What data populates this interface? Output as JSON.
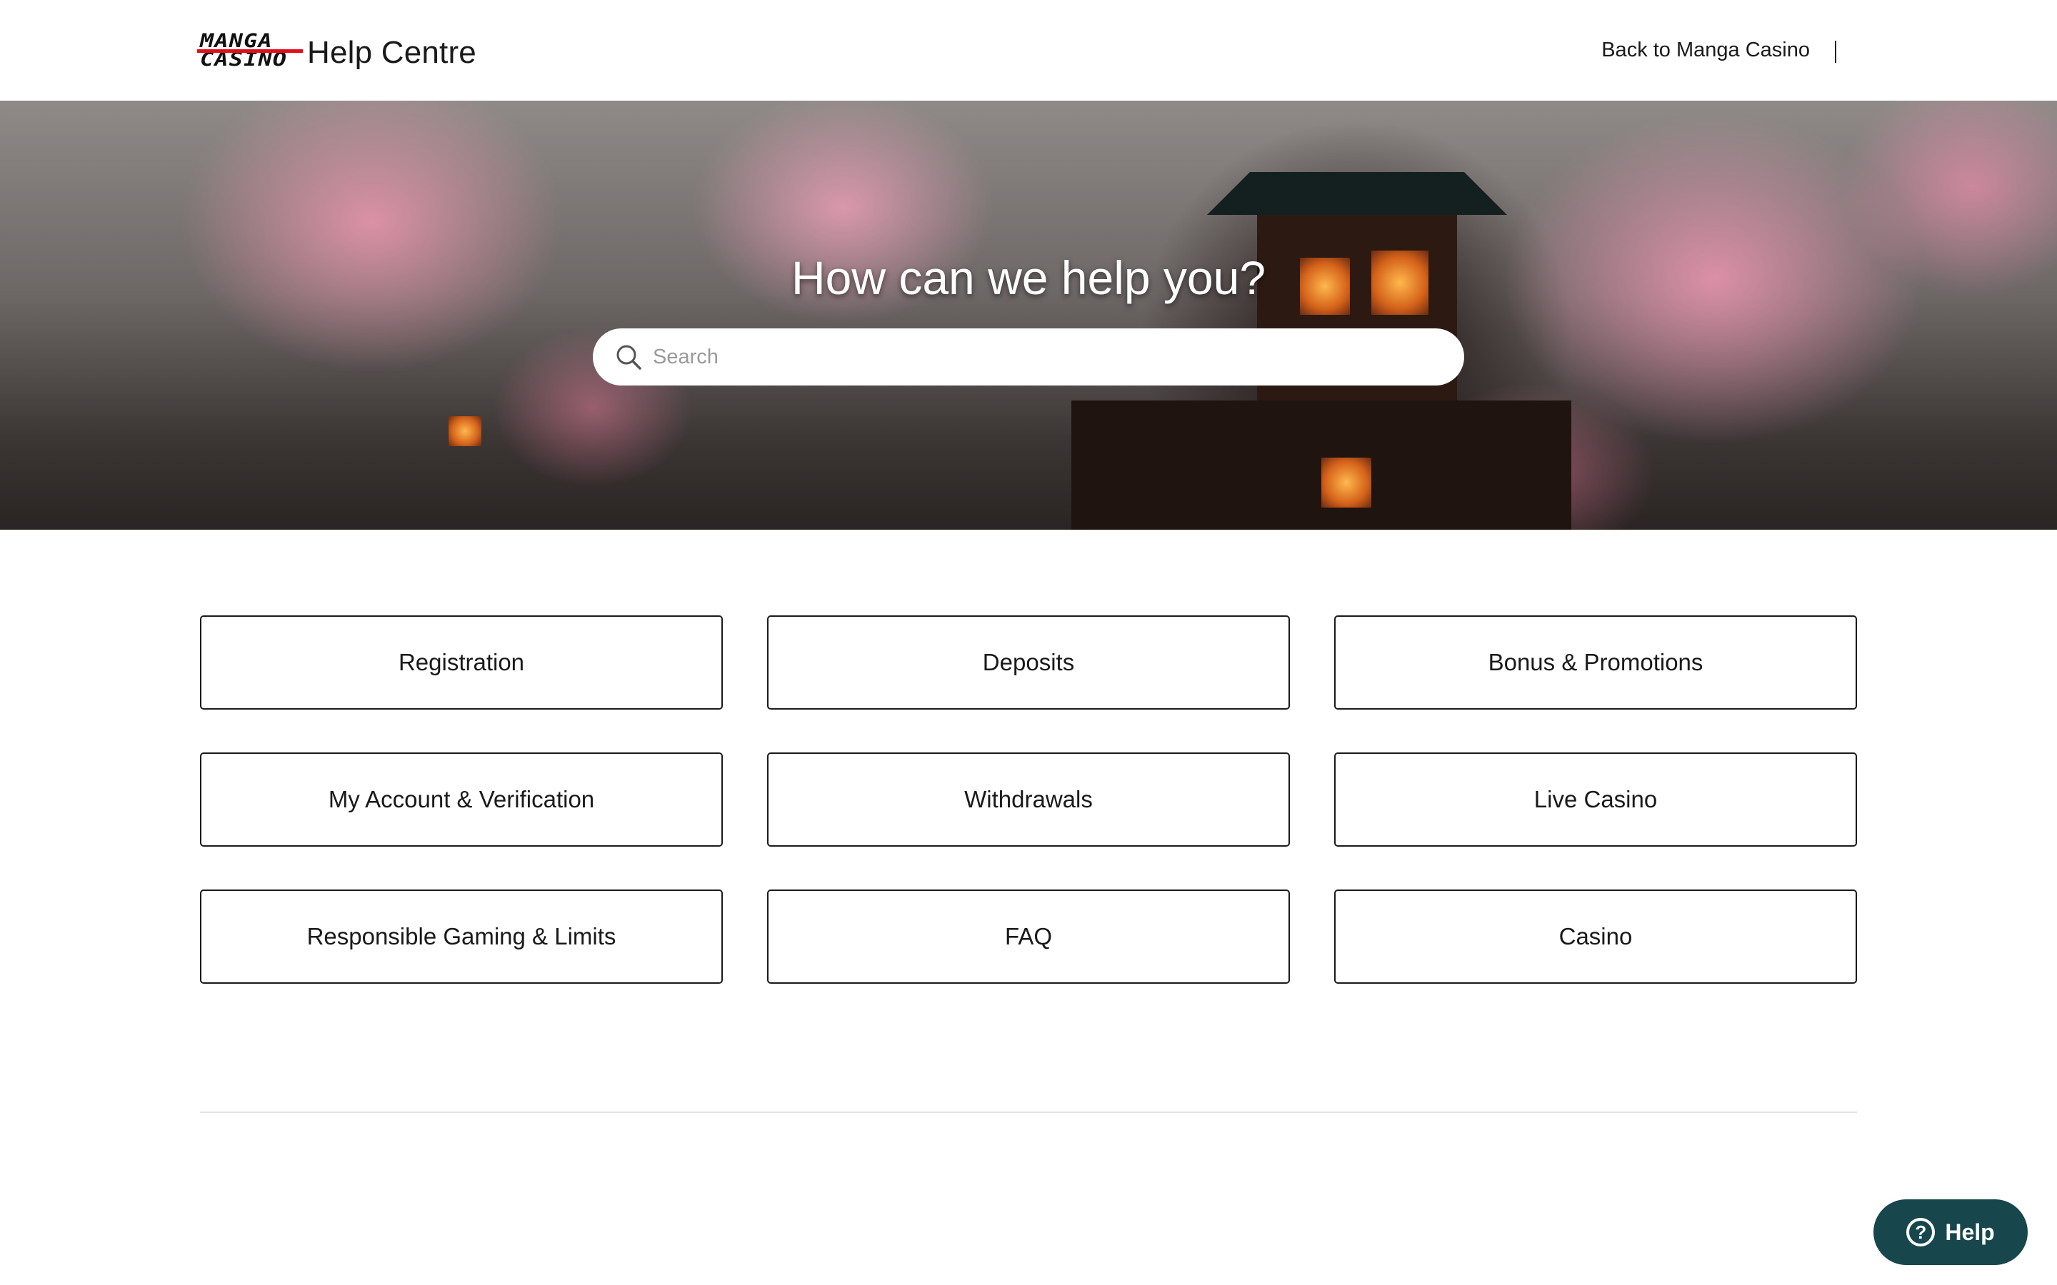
{
  "header": {
    "logo_line_1": "MANGA",
    "logo_line_2": "CASINO",
    "title": "Help Centre",
    "back_link": "Back to Manga Casino"
  },
  "hero": {
    "heading": "How can we help you?",
    "search_placeholder": "Search",
    "search_value": ""
  },
  "categories": [
    {
      "label": "Registration"
    },
    {
      "label": "Deposits"
    },
    {
      "label": "Bonus & Promotions"
    },
    {
      "label": "My Account & Verification"
    },
    {
      "label": "Withdrawals"
    },
    {
      "label": "Live Casino"
    },
    {
      "label": "Responsible Gaming & Limits"
    },
    {
      "label": "FAQ"
    },
    {
      "label": "Casino"
    }
  ],
  "help_widget": {
    "label": "Help",
    "icon": "question-circle-icon",
    "color": "#17474d"
  },
  "colors": {
    "logo_accent": "#e0101a",
    "text": "#1a1a1a",
    "card_border": "#1a1a1a"
  }
}
